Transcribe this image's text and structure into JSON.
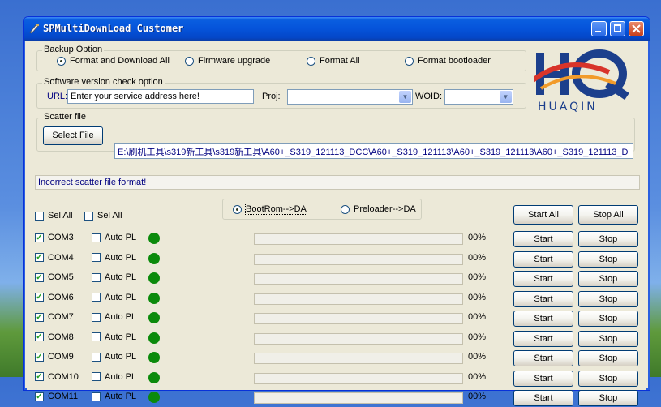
{
  "window": {
    "title": "SPMultiDownLoad Customer"
  },
  "backup": {
    "label": "Backup Option",
    "options": [
      "Format and Download All",
      "Firmware upgrade",
      "Format All",
      "Format bootloader"
    ],
    "selected": 0
  },
  "version_check": {
    "label": "Software version check option",
    "url_label": "URL:",
    "url_value": "Enter your service address here!",
    "proj_label": "Proj:",
    "proj_value": "",
    "woid_label": "WOID:",
    "woid_value": ""
  },
  "scatter": {
    "label": "Scatter file",
    "select_button": "Select File",
    "path": "E:\\刷机工具\\s319新工具\\s319新工具\\A60+_S319_121113_DCC\\A60+_S319_121113\\A60+_S319_121113\\A60+_S319_121113_D"
  },
  "status_message": "Incorrect scatter file format!",
  "logo": {
    "text": "HUAQIN",
    "colors": {
      "primary": "#1c3f8c",
      "accent": "#d8342a",
      "orange": "#f29b2a"
    }
  },
  "boot_mode": {
    "options": [
      "BootRom-->DA",
      "Preloader-->DA"
    ],
    "selected": 0
  },
  "select_all": [
    "Sel All",
    "Sel All"
  ],
  "global_buttons": {
    "start_all": "Start All",
    "stop_all": "Stop All"
  },
  "ports": [
    {
      "com": "COM3",
      "auto": "Auto PL",
      "progress": "00%",
      "progress_value": 0
    },
    {
      "com": "COM4",
      "auto": "Auto PL",
      "progress": "00%",
      "progress_value": 0
    },
    {
      "com": "COM5",
      "auto": "Auto PL",
      "progress": "00%",
      "progress_value": 0
    },
    {
      "com": "COM6",
      "auto": "Auto PL",
      "progress": "00%",
      "progress_value": 0
    },
    {
      "com": "COM7",
      "auto": "Auto PL",
      "progress": "00%",
      "progress_value": 0
    },
    {
      "com": "COM8",
      "auto": "Auto PL",
      "progress": "00%",
      "progress_value": 0
    },
    {
      "com": "COM9",
      "auto": "Auto PL",
      "progress": "00%",
      "progress_value": 0
    },
    {
      "com": "COM10",
      "auto": "Auto PL",
      "progress": "00%",
      "progress_value": 0
    },
    {
      "com": "COM11",
      "auto": "Auto PL",
      "progress": "00%",
      "progress_value": 0
    }
  ],
  "port_buttons": {
    "start": "Start",
    "stop": "Stop"
  },
  "status_colors": {
    "port_ready": "#0b8a0b",
    "link_text": "#000080"
  }
}
